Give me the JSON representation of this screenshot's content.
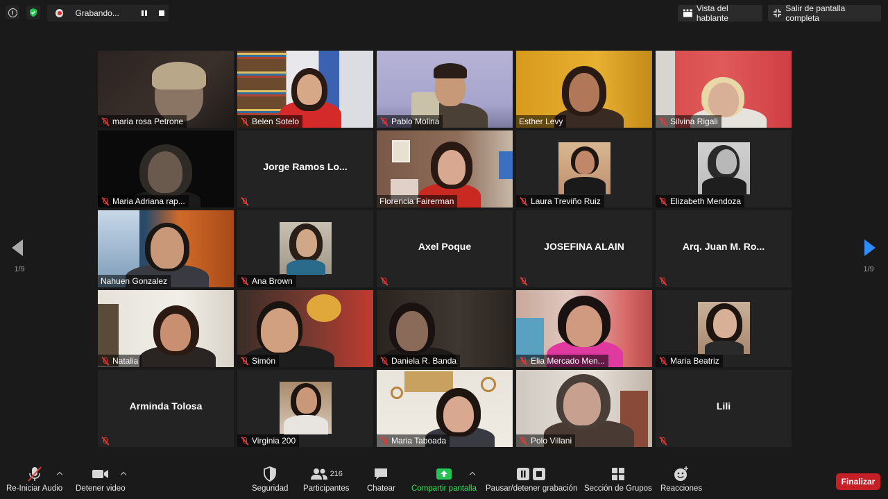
{
  "top_bar": {
    "recording_label": "Grabando...",
    "speaker_view_label": "Vista del hablante",
    "exit_fullscreen_label": "Salir de pantalla completa"
  },
  "pagination": {
    "left_page": "1/9",
    "right_page": "1/9"
  },
  "participants": [
    {
      "name": "maria rosa Petrone",
      "video": true,
      "muted": true
    },
    {
      "name": "Belen Sotelo",
      "video": true,
      "muted": true
    },
    {
      "name": "Pablo Molina",
      "video": true,
      "muted": true
    },
    {
      "name": "Esther Levy",
      "video": true,
      "muted": false
    },
    {
      "name": "Silvina Rigali",
      "video": true,
      "muted": true
    },
    {
      "name": "Maria Adriana rap...",
      "video": true,
      "muted": true
    },
    {
      "name": "Jorge Ramos Lo...",
      "video": false,
      "muted": true
    },
    {
      "name": "Florencia Fairerman",
      "video": true,
      "muted": false,
      "active_speaker": true
    },
    {
      "name": "Laura Treviño Ruiz",
      "video": false,
      "avatar": true,
      "muted": true
    },
    {
      "name": "Elizabeth Mendoza",
      "video": false,
      "avatar": true,
      "muted": true
    },
    {
      "name": "Nahuen Gonzalez",
      "video": true,
      "muted": false
    },
    {
      "name": "Ana Brown",
      "video": false,
      "avatar": true,
      "muted": true
    },
    {
      "name": "Axel Poque",
      "video": false,
      "muted": true
    },
    {
      "name": "JOSEFINA ALAIN",
      "video": false,
      "muted": true
    },
    {
      "name": "Arq. Juan M. Ro...",
      "video": false,
      "muted": true
    },
    {
      "name": "Natalia",
      "video": true,
      "muted": true
    },
    {
      "name": "Simón",
      "video": true,
      "muted": true
    },
    {
      "name": "Daniela R. Banda",
      "video": true,
      "muted": true
    },
    {
      "name": "Elia Mercado Men...",
      "video": true,
      "muted": true
    },
    {
      "name": "Maria Beatriz",
      "video": false,
      "avatar": true,
      "muted": true
    },
    {
      "name": "Arminda Tolosa",
      "video": false,
      "muted": true
    },
    {
      "name": "Virginia 200",
      "video": false,
      "avatar": true,
      "muted": true
    },
    {
      "name": "Maria Taboada",
      "video": true,
      "muted": true
    },
    {
      "name": "Polo Villani",
      "video": true,
      "muted": true
    },
    {
      "name": "Lili",
      "video": false,
      "muted": true
    }
  ],
  "toolbar": {
    "audio_label": "Re-Iniciar Audio",
    "video_label": "Detener video",
    "security_label": "Seguridad",
    "participants_label": "Participantes",
    "participants_count": "216",
    "chat_label": "Chatear",
    "share_label": "Compartir pantalla",
    "recording_label": "Pausar/detener grabación",
    "breakout_label": "Sección de Grupos",
    "reactions_label": "Reacciones",
    "end_label": "Finalizar"
  },
  "colors": {
    "background": "#1a1a1a",
    "tile": "#232323",
    "active_border": "#b8db4a",
    "muted_icon": "#e03a3a",
    "share_green": "#3ddc5a",
    "end_red": "#c61f26",
    "nav_blue": "#2d8cff"
  }
}
